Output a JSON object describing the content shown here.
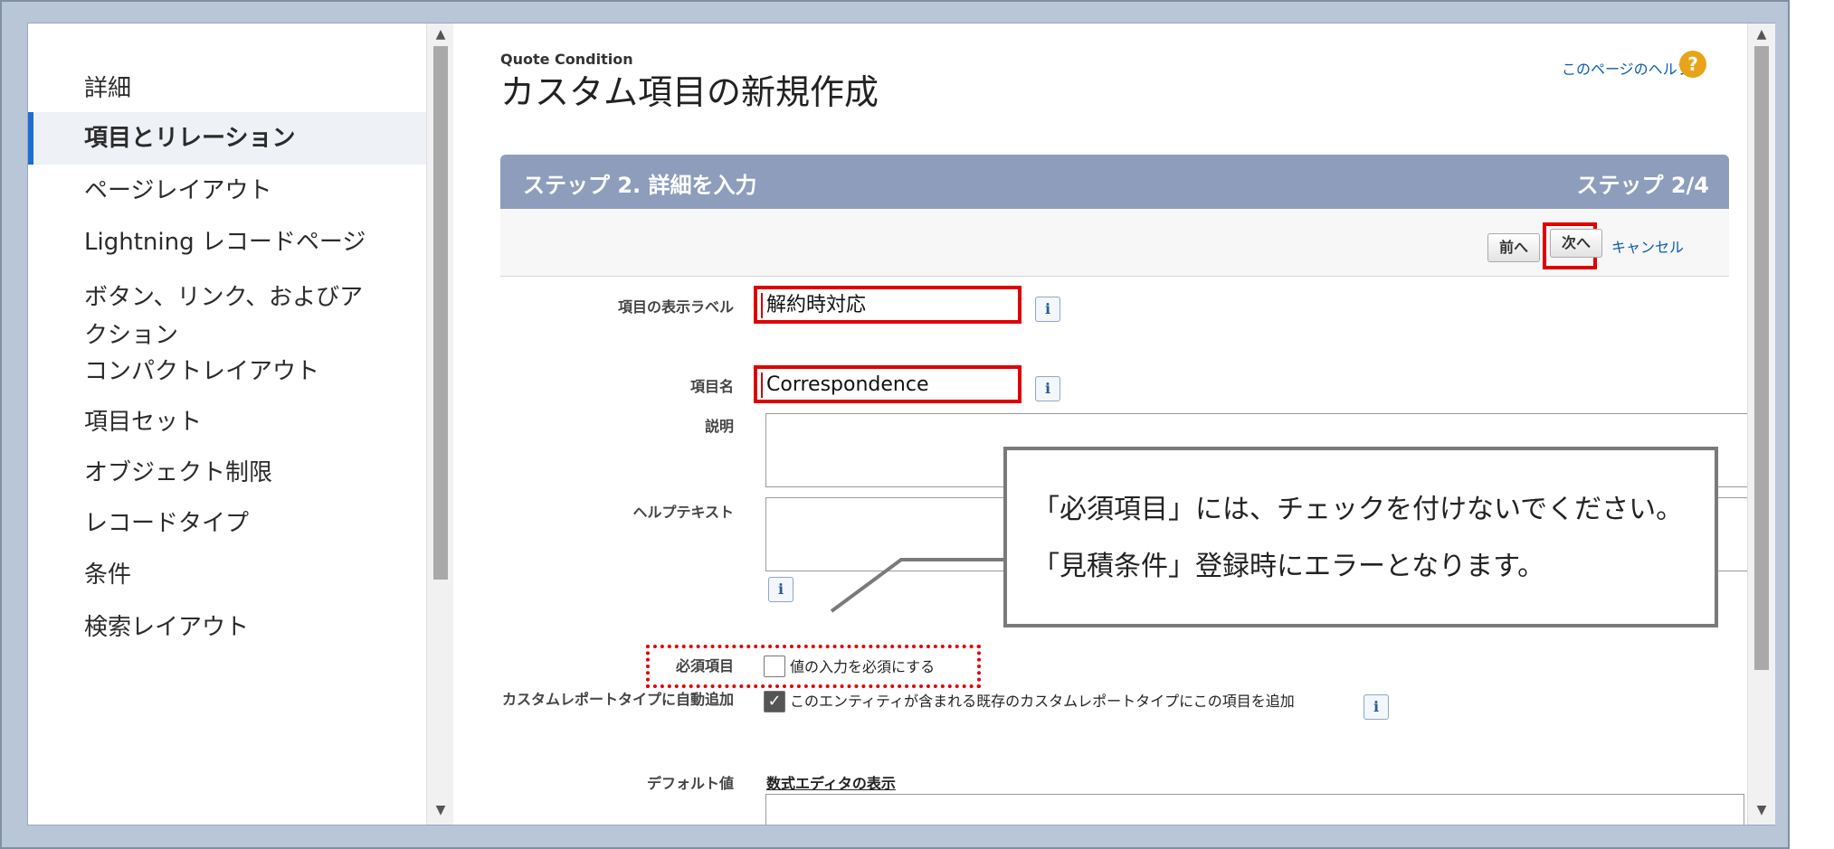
{
  "sidebar": {
    "items": [
      {
        "label": "詳細",
        "active": false
      },
      {
        "label": "項目とリレーション",
        "active": true
      },
      {
        "label": "ページレイアウト",
        "active": false
      },
      {
        "label": "Lightning レコードページ",
        "active": false
      },
      {
        "label": "ボタン、リンク、およびア",
        "label2": "クション",
        "active": false
      },
      {
        "label": "コンパクトレイアウト",
        "active": false
      },
      {
        "label": "項目セット",
        "active": false
      },
      {
        "label": "オブジェクト制限",
        "active": false
      },
      {
        "label": "レコードタイプ",
        "active": false
      },
      {
        "label": "条件",
        "active": false
      },
      {
        "label": "検索レイアウト",
        "active": false
      }
    ]
  },
  "header": {
    "object_name": "Quote Condition",
    "title": "カスタム項目の新規作成",
    "help_link": "このページのヘルプ",
    "help_icon": "?"
  },
  "step": {
    "left": "ステップ 2. 詳細を入力",
    "right": "ステップ 2/4"
  },
  "buttons": {
    "prev": "前へ",
    "next": "次へ",
    "cancel": "キャンセル"
  },
  "form": {
    "label_label": "項目の表示ラベル",
    "label_value": "解約時対応",
    "name_label": "項目名",
    "name_value": "Correspondence",
    "description_label": "説明",
    "helptext_label": "ヘルプテキスト",
    "required_label": "必須項目",
    "required_text": "値の入力を必須にする",
    "required_checked": false,
    "report_label": "カスタムレポートタイプに自動追加",
    "report_text": "このエンティティが含まれる既存のカスタムレポートタイプにこの項目を追加",
    "report_checked": true,
    "default_label": "デフォルト値",
    "formula_link": "数式エディタの表示",
    "info_icon": "i",
    "check_mark": "✓"
  },
  "callout": {
    "line1": "「必須項目」には、チェックを付けないでください。",
    "line2": "「見積条件」登録時にエラーとなります。"
  },
  "colors": {
    "highlight_red": "#e00000",
    "step_bar": "#8e9dbb",
    "active_accent": "#1f6dd1"
  }
}
